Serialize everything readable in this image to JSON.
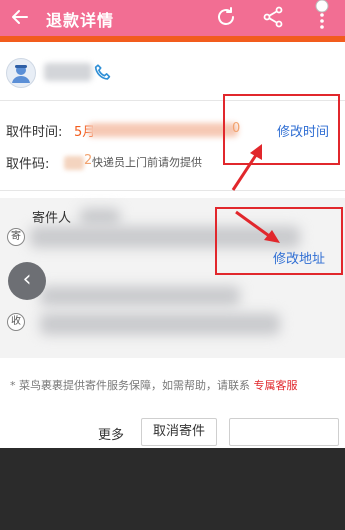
{
  "header": {
    "title": "退款详情",
    "color": "#f26e93",
    "strip_color": "#f25c1d"
  },
  "pickup": {
    "time_label": "取件时间:",
    "time_value_prefix": "5月",
    "time_value_suffix": "0",
    "time_edit": "修改时间",
    "code_label": "取件码:",
    "code_suffix": "2",
    "code_hint": "快递员上门前请勿提供"
  },
  "address": {
    "sender_label": "寄件人",
    "sender_icon": "寄",
    "receiver_icon": "收",
    "edit_address": "修改地址"
  },
  "note": {
    "text": "菜鸟裹裹提供寄件服务保障，如需帮助，请联系",
    "link": "专属客服"
  },
  "actions": {
    "more": "更多",
    "cancel": "取消寄件"
  },
  "icons": [
    "back-arrow-icon",
    "refresh-icon",
    "share-icon",
    "more-vertical-icon",
    "phone-icon",
    "avatar-icon"
  ],
  "colors": {
    "accent": "#f25c1d",
    "link": "#2f6ed3",
    "annotation": "#e1272c"
  }
}
